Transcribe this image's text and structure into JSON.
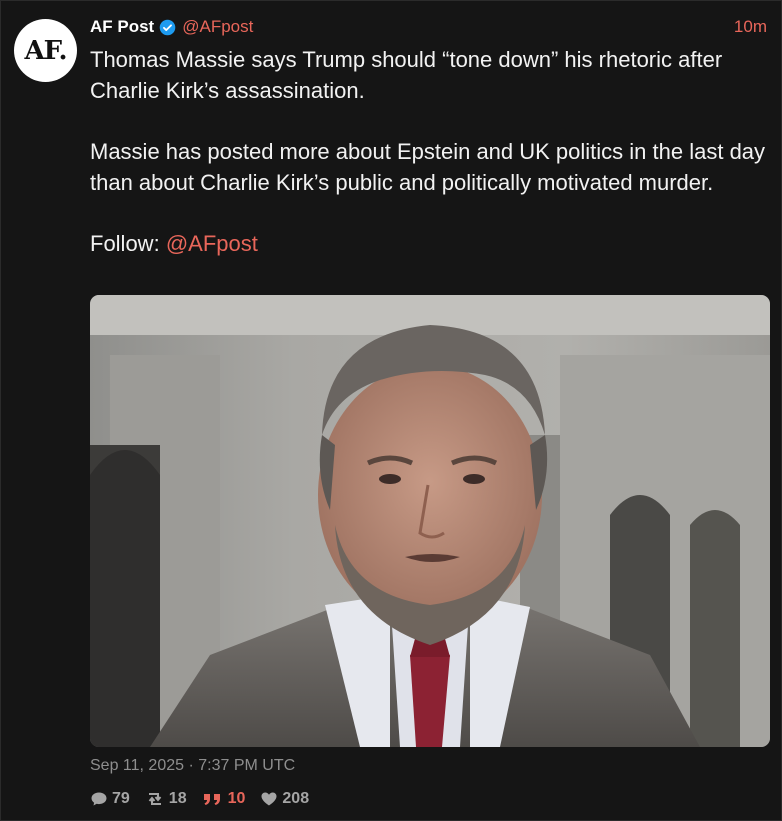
{
  "post": {
    "avatar_text": "AF.",
    "display_name": "AF Post",
    "handle": "@AFpost",
    "time_ago": "10m",
    "paragraph1": "Thomas Massie says Trump should “tone down” his rhetoric after Charlie Kirk’s assassination.",
    "paragraph2": "Massie has posted more about Epstein and UK politics in the last day than about Charlie Kirk’s public and politically motivated murder.",
    "follow_label": "Follow:",
    "follow_handle": "@AFpost",
    "date_line": "Sep 11, 2025 · 7:37 PM UTC",
    "stats": {
      "replies": "79",
      "reposts": "18",
      "quotes": "10",
      "likes": "208"
    }
  },
  "icons": {
    "verified": "verified-badge-icon",
    "reply": "comment-bubble-icon",
    "repost": "retweet-icon",
    "quote": "quote-icon",
    "like": "heart-icon"
  },
  "colors": {
    "accent": "#e8665a",
    "verified": "#1d9bf0",
    "background": "#151515",
    "muted": "#8e8e8e"
  }
}
